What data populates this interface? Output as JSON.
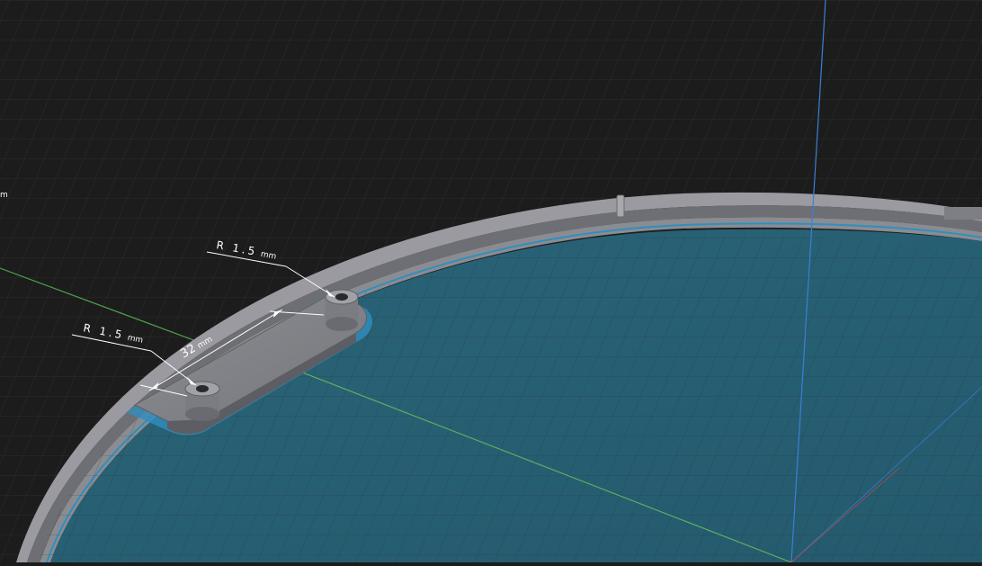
{
  "colors": {
    "background": "#1c1c1c",
    "grid": "#2c2c2c",
    "floor": "#2e6b80",
    "rim": "#8a8a8f",
    "accent_line": "#2f8fbf",
    "axis_y": "#4f9f4f",
    "axis_z": "#3a7fd8",
    "axis_x": "#b44a4a"
  },
  "annotations": {
    "hole_radius_top": {
      "value": "R 1.5",
      "unit": "mm"
    },
    "hole_radius_left": {
      "value": "R 1.5",
      "unit": "mm"
    },
    "length": {
      "value": "32",
      "unit": "mm"
    },
    "edge_label": {
      "value": "",
      "unit": "m"
    }
  }
}
